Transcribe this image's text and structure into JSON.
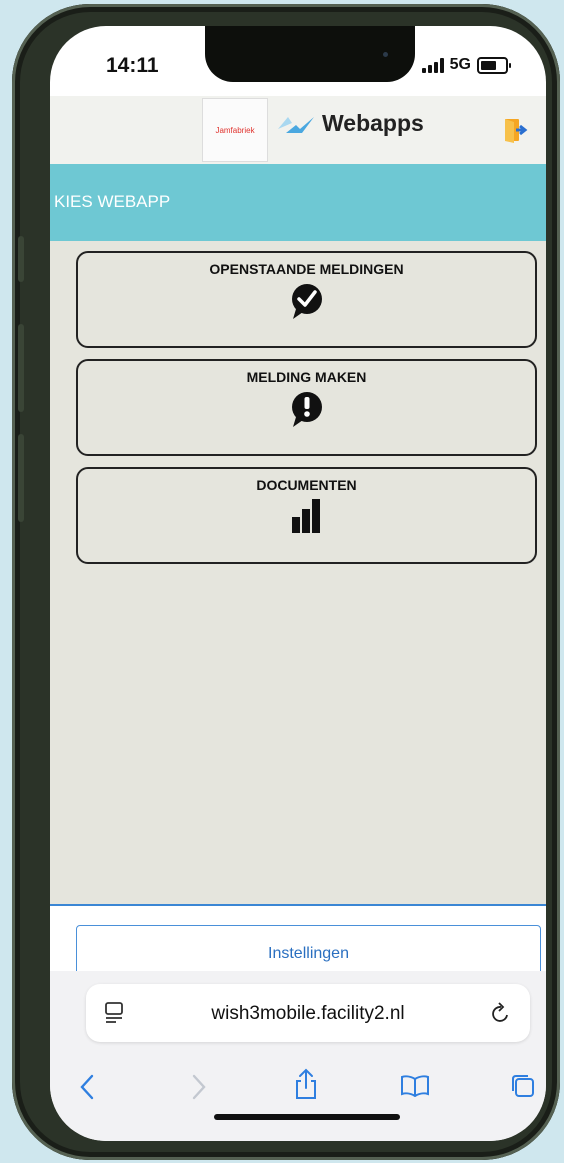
{
  "status_bar": {
    "time": "14:11",
    "network": "5G"
  },
  "app_bar": {
    "partner_logo_text": "Jamfabriek",
    "title": "Webapps"
  },
  "section_header": {
    "label": "KIES WEBAPP"
  },
  "tiles": [
    {
      "label": "OPENSTAANDE MELDINGEN",
      "icon": "check-bubble-icon"
    },
    {
      "label": "MELDING MAKEN",
      "icon": "exclamation-bubble-icon"
    },
    {
      "label": "DOCUMENTEN",
      "icon": "bar-chart-icon"
    }
  ],
  "settings": {
    "label": "Instellingen"
  },
  "browser": {
    "url": "wish3mobile.facility2.nl"
  },
  "colors": {
    "accent_cyan": "#6ec8d3",
    "link_blue": "#2a6fc0",
    "background": "#e5e5dd"
  }
}
